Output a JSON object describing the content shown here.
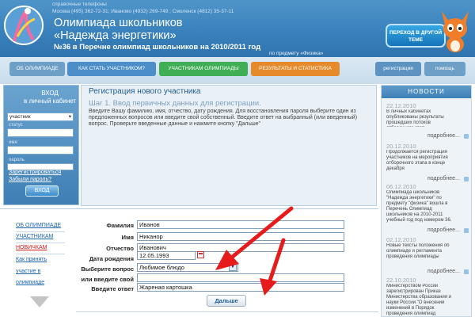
{
  "header": {
    "phones_line1": "справочные телефоны",
    "phones_line2": "Москва (495) 362-72-31; Иваново (4932) 269-749 ; Смоленск (4812) 35-37-11",
    "title_line1": "Олимпиада школьников",
    "title_line2": "«Надежда энергетики»",
    "title_line3": "№36 в Перечне олимпиад школьников на 2010/2011 год",
    "subject": "по предмету «Физика»",
    "switch_theme": "ПЕРЕХОД В ДРУГОЙ ТЕМЕ"
  },
  "nav": {
    "tabs": [
      {
        "label": "ОБ ОЛИМПИАДЕ",
        "color": "#6e9fc6"
      },
      {
        "label": "КАК СТАТЬ УЧАСТНИКОМ?",
        "color": "#4c8ec7"
      },
      {
        "label": "УЧАСТНИКАМ ОЛИМПИАДЫ",
        "color": "#3fae54"
      },
      {
        "label": "РЕЗУЛЬТАТЫ И СТАТИСТИКА",
        "color": "#e78a2c"
      },
      {
        "label": "регистрация",
        "color": "#5c93c0"
      },
      {
        "label": "помощь",
        "color": "#6e9fc6"
      }
    ]
  },
  "login": {
    "title": "ВХОД\nв личный кабинет",
    "role": "участник",
    "status_label": "статус",
    "name_label": "имя",
    "password_label": "пароль",
    "register_link": "Зарегистрироваться",
    "forgot_link": "Забыли пароль?",
    "button": "ВХОД"
  },
  "registration": {
    "title": "Регистрация нового участника",
    "step": "Шаг 1. Ввод первичных данных для регистрации.",
    "description": "Введите Вашу фамилию, имя, отчество, дату рождения. Для восстановления пароля выберите один из предложенных вопросов или введите свой собственный. Введите ответ на выбранный (или введенный) вопрос. Проверьте введенные данные и нажмите кнопку \"Дальше\""
  },
  "left_menu": {
    "items": [
      "ОБ ОЛИМПИАДЕ",
      "УЧАСТНИКАМ",
      "НОВИЧКАМ",
      "Как принять",
      "участие в",
      "олимпиаде"
    ],
    "colors": [
      "#1a63ad",
      "#1a63ad",
      "#d01a1a",
      "#1a63ad",
      "#1a63ad",
      "#1a63ad"
    ]
  },
  "form": {
    "fields": [
      {
        "label": "Фамилия",
        "value": "Иванов"
      },
      {
        "label": "Имя",
        "value": "Никанор"
      },
      {
        "label": "Отчество",
        "value": "Иванович"
      },
      {
        "label": "Дата рождения",
        "value": "12.05.1993"
      },
      {
        "label": "Выберите вопрос",
        "value": "Любимое блюдо"
      },
      {
        "label": "или введите свой",
        "value": ""
      },
      {
        "label": "Введите ответ",
        "value": "Жареная картошка"
      }
    ],
    "submit": "Дальше"
  },
  "news": {
    "heading": "НОВОСТИ",
    "more": "подробнее...",
    "items": [
      {
        "date": "22.12.2010",
        "text": "В личных кабинетах опубликованы результаты прошедших потоков отборочного этап..."
      },
      {
        "date": "20.12.2010",
        "text": "Продолжается регистрация участников на мероприятия отборочного этапа в конце декабря"
      },
      {
        "date": "06.12.2010",
        "text": "Олимпиада школьников \"Надежда энергетики\" по предмету \"физика\" вошла в Перечень Олимпиад школьников на 2010-2011 учебный год под номером 36."
      },
      {
        "date": "02.12.2010",
        "text": "Новые тексты положения об олимпиаде и регламента проведения олимпиады"
      },
      {
        "date": "22.10.2010",
        "text": "Министерством России зарегистрирован Приказ Министерства образования и науки России \"О внесении изменений в Порядок проведения олимпиад школьников\""
      }
    ]
  }
}
